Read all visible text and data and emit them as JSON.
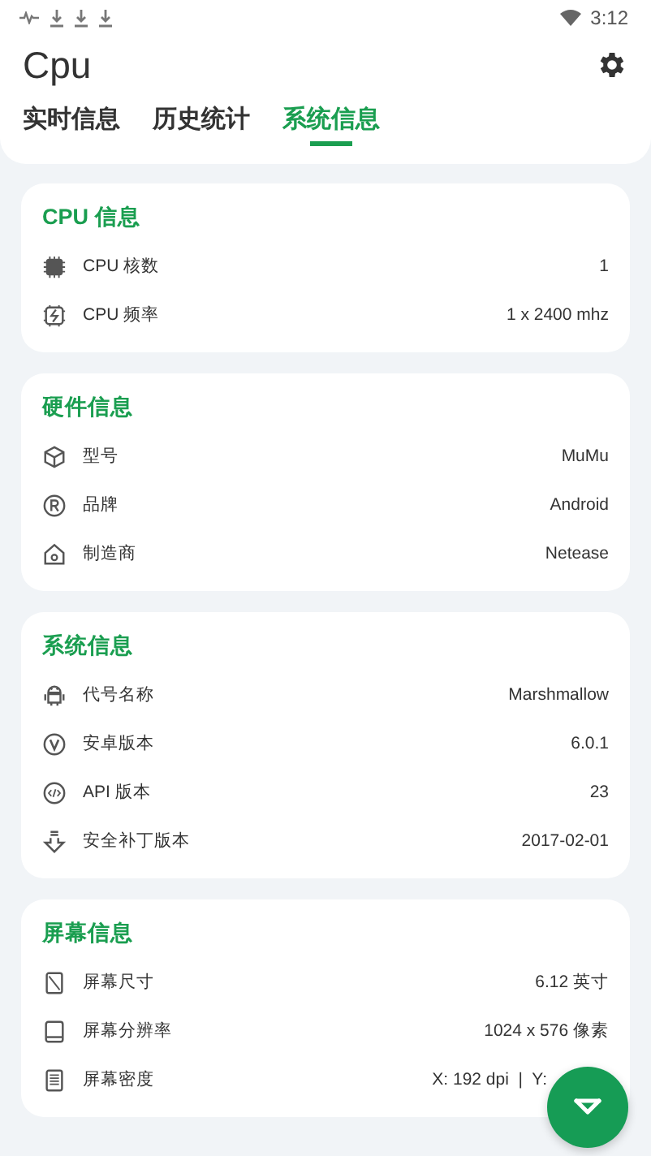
{
  "status_bar": {
    "time": "3:12"
  },
  "app_bar": {
    "title": "Cpu"
  },
  "tabs": [
    {
      "label": "实时信息",
      "selected": false
    },
    {
      "label": "历史统计",
      "selected": false
    },
    {
      "label": "系统信息",
      "selected": true
    }
  ],
  "sections": [
    {
      "title": "CPU 信息",
      "rows": [
        {
          "label": "CPU 核数",
          "value": "1"
        },
        {
          "label": "CPU 频率",
          "value": "1 x 2400 mhz"
        }
      ]
    },
    {
      "title": "硬件信息",
      "rows": [
        {
          "label": "型号",
          "value": "MuMu"
        },
        {
          "label": "品牌",
          "value": "Android"
        },
        {
          "label": "制造商",
          "value": "Netease"
        }
      ]
    },
    {
      "title": "系统信息",
      "rows": [
        {
          "label": "代号名称",
          "value": "Marshmallow"
        },
        {
          "label": "安卓版本",
          "value": "6.0.1"
        },
        {
          "label": "API 版本",
          "value": "23"
        },
        {
          "label": "安全补丁版本",
          "value": "2017-02-01"
        }
      ]
    },
    {
      "title": "屏幕信息",
      "rows": [
        {
          "label": "屏幕尺寸",
          "value": "6.12 英寸"
        },
        {
          "label": "屏幕分辨率",
          "value": "1024 x 576 像素"
        },
        {
          "label": "屏幕密度",
          "value": "X: 192 dpi  |  Y:"
        }
      ]
    }
  ]
}
